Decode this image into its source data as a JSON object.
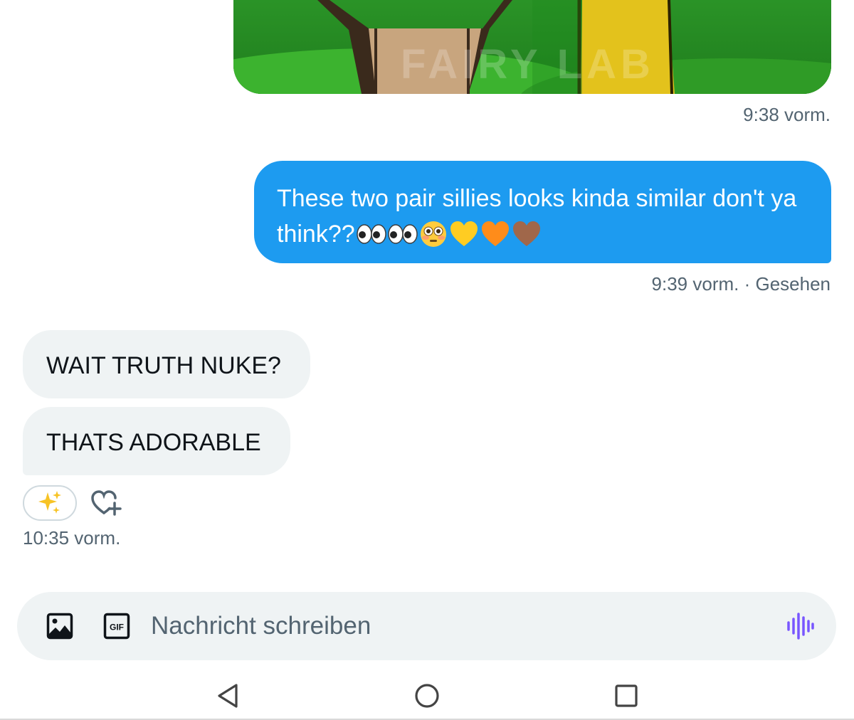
{
  "conversation": {
    "messages": [
      {
        "id": "sent-media",
        "direction": "outgoing",
        "type": "image",
        "watermark_text": "FAIRY LAB",
        "timestamp": "9:38 vorm."
      },
      {
        "id": "sent-text",
        "direction": "outgoing",
        "type": "text",
        "text": "These two pair sillies looks kinda similar don't ya think??",
        "emojis": [
          "eyes-emoji",
          "eyes-emoji",
          "flushed-face-emoji",
          "yellow-heart-emoji",
          "orange-heart-emoji",
          "brown-heart-emoji"
        ],
        "timestamp": "9:39 vorm. · Gesehen"
      },
      {
        "id": "recv-1",
        "direction": "incoming",
        "type": "text",
        "text": "WAIT TRUTH NUKE?"
      },
      {
        "id": "recv-2",
        "direction": "incoming",
        "type": "text",
        "text": "THATS ADORABLE",
        "reactions": [
          "sparkles-emoji"
        ],
        "timestamp": "10:35 vorm."
      }
    ]
  },
  "composer": {
    "placeholder": "Nachricht schreiben",
    "value": "",
    "gif_label": "GIF",
    "icons": [
      "image-icon",
      "gif-icon",
      "voice-message-icon"
    ]
  },
  "system_nav": {
    "icons": [
      "back-icon",
      "home-icon",
      "recents-icon"
    ]
  },
  "colors": {
    "sent_bubble": "#1d9bf0",
    "received_bubble": "#eff3f4",
    "timestamp_text": "#536471",
    "voice_accent": "#7856ff"
  }
}
